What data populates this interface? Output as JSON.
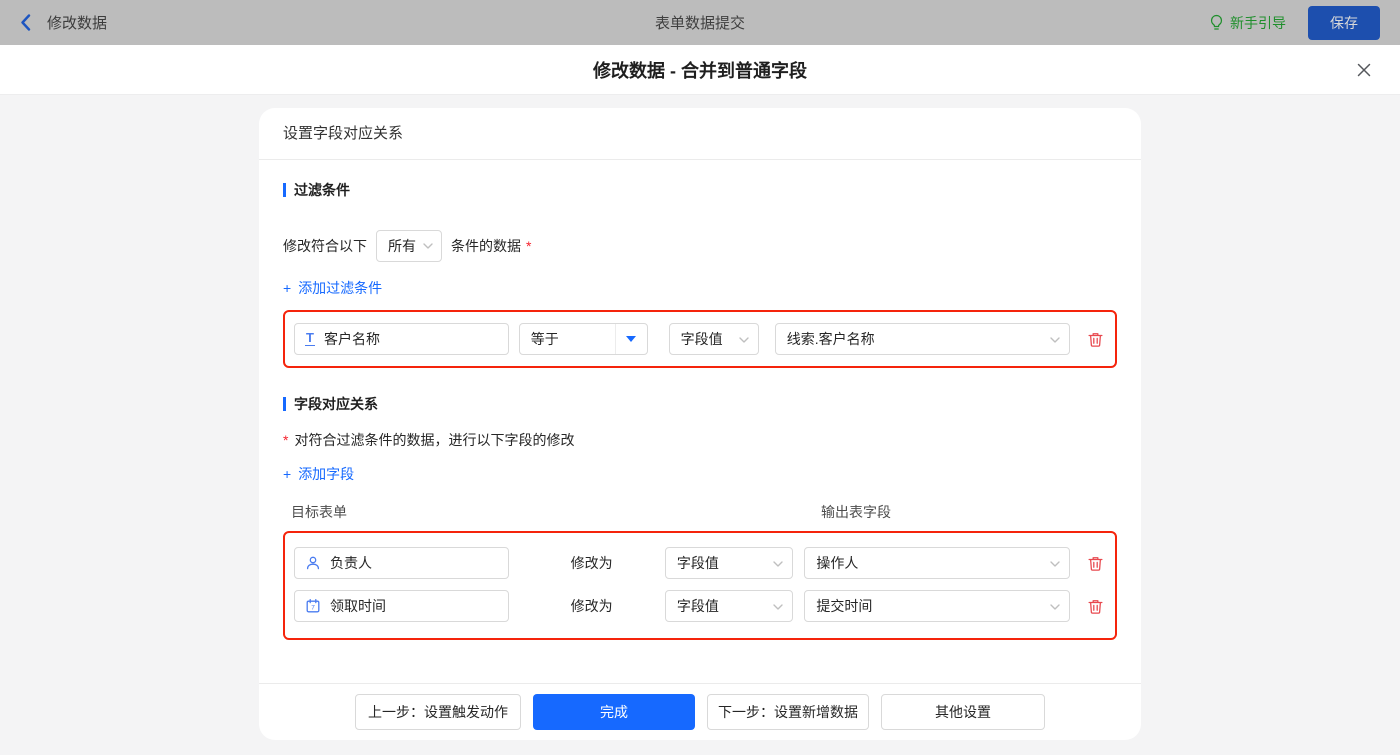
{
  "topbar": {
    "back_label": "修改数据",
    "title": "表单数据提交",
    "guide_label": "新手引导",
    "save_label": "保存"
  },
  "modal": {
    "title": "修改数据 - 合并到普通字段"
  },
  "panel": {
    "header": "设置字段对应关系",
    "filter_section": {
      "title": "过滤条件",
      "condition_prefix": "修改符合以下",
      "condition_select_value": "所有",
      "condition_suffix": "条件的数据",
      "required_mark": "*",
      "add_icon": "+",
      "add_label": "添加过滤条件",
      "rows": [
        {
          "field": "客户名称",
          "field_icon": "text-field-icon",
          "field_icon_glyph": "T",
          "operator": "等于",
          "value_type": "字段值",
          "value": "线索.客户名称"
        }
      ]
    },
    "mapping_section": {
      "title": "字段对应关系",
      "required_mark": "*",
      "hint": "对符合过滤条件的数据，进行以下字段的修改",
      "add_icon": "+",
      "add_label": "添加字段",
      "col_left": "目标表单",
      "col_right": "输出表字段",
      "rows": [
        {
          "field": "负责人",
          "field_icon": "user-icon",
          "action_label": "修改为",
          "value_type": "字段值",
          "value": "操作人"
        },
        {
          "field": "领取时间",
          "field_icon": "calendar-icon",
          "action_label": "修改为",
          "value_type": "字段值",
          "value": "提交时间"
        }
      ]
    },
    "footer": {
      "prev_label": "上一步：设置触发动作",
      "done_label": "完成",
      "next_label": "下一步：设置新增数据",
      "other_label": "其他设置"
    }
  },
  "icons": {
    "back": "chevron-left-icon",
    "guide": "lightbulb-icon",
    "close": "close-icon",
    "select_caret": "chevron-down-icon",
    "delete": "trash-icon"
  },
  "colors": {
    "accent_blue": "#1669ff",
    "highlight_red": "#f5240c",
    "trash_red": "#e8484e",
    "guide_green": "#1f8f2c",
    "required_red": "#f5222d",
    "topbar_bg": "#bcbcbc",
    "page_bg": "#f4f4f5"
  }
}
